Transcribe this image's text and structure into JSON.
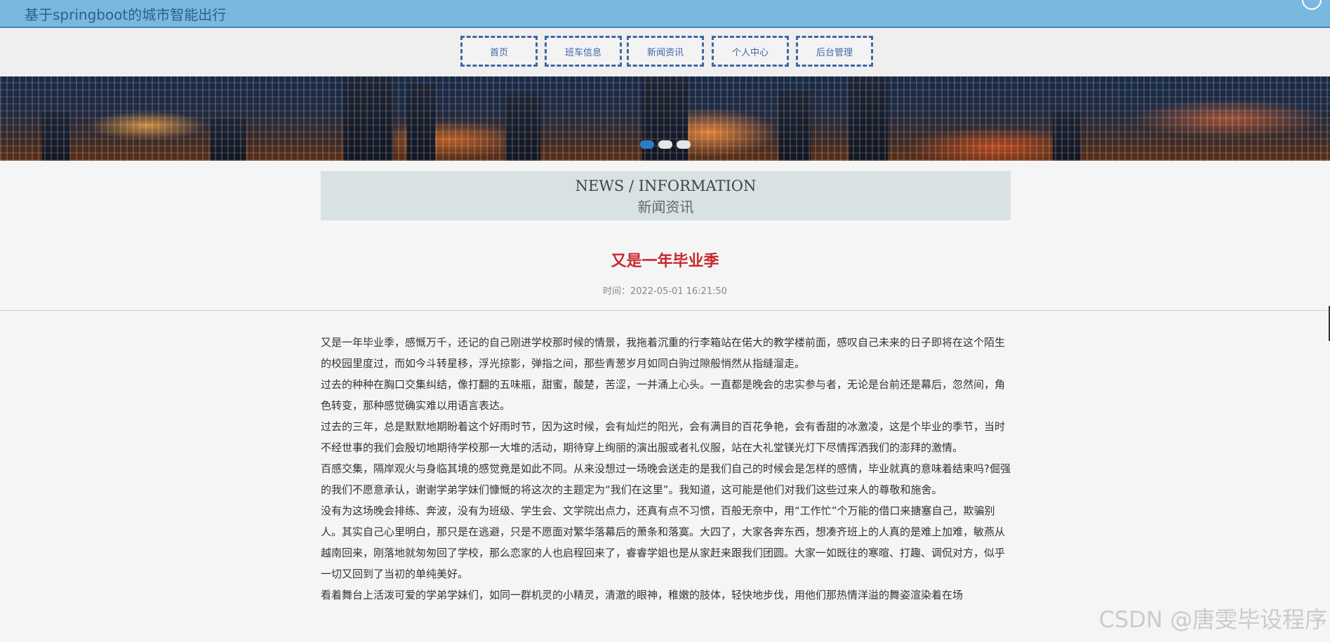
{
  "header": {
    "site_title": "基于springboot的城市智能出行"
  },
  "nav": {
    "items": [
      {
        "label": "首页"
      },
      {
        "label": "班车信息"
      },
      {
        "label": "新闻资讯"
      },
      {
        "label": "个人中心"
      },
      {
        "label": "后台管理"
      }
    ]
  },
  "section": {
    "title_en": "NEWS / INFORMATION",
    "title_zh": "新闻资讯"
  },
  "article": {
    "title": "又是一年毕业季",
    "time": "时间：2022-05-01 16:21:50",
    "paragraphs": [
      "又是一年毕业季，感慨万千，还记的自己刚进学校那时候的情景，我拖着沉重的行李箱站在偌大的教学楼前面，感叹自己未来的日子即将在这个陌生的校园里度过，而如今斗转星移，浮光掠影，弹指之间，那些青葱岁月如同白驹过隙般悄然从指缝溜走。",
      "过去的种种在胸口交集纠结，像打翻的五味瓶，甜蜜，酸楚，苦涩，一并涌上心头。一直都是晚会的忠实参与者，无论是台前还是幕后，忽然间，角色转变，那种感觉确实难以用语言表达。",
      "过去的三年，总是默默地期盼着这个好雨时节，因为这时候，会有灿烂的阳光，会有满目的百花争艳，会有香甜的冰激凌，这是个毕业的季节，当时不经世事的我们会殷切地期待学校那一大堆的活动，期待穿上绚丽的演出服或者礼仪服，站在大礼堂镁光灯下尽情挥洒我们的澎拜的激情。",
      "百感交集，隔岸观火与身临其境的感觉竟是如此不同。从来没想过一场晚会送走的是我们自己的时候会是怎样的感情，毕业就真的意味着结束吗?倔强的我们不愿意承认，谢谢学弟学妹们慷慨的将这次的主题定为“我们在这里”。我知道，这可能是他们对我们这些过来人的尊敬和施舍。",
      "没有为这场晚会排练、奔波，没有为班级、学生会、文学院出点力，还真有点不习惯，百般无奈中，用“工作忙”个万能的借口来搪塞自己，欺骗别人。其实自己心里明白，那只是在逃避，只是不愿面对繁华落幕后的萧条和落寞。大四了，大家各奔东西，想凑齐班上的人真的是难上加难，敏燕从越南回来，刚落地就匆匆回了学校，那么恋家的人也启程回来了，睿睿学姐也是从家赶来跟我们团圆。大家一如既往的寒暄、打趣、调侃对方，似乎一切又回到了当初的单纯美好。",
      "看着舞台上活泼可爱的学弟学妹们，如同一群机灵的小精灵，清澈的眼神，稚嫩的肢体，轻快地步伐，用他们那热情洋溢的舞姿渲染着在场"
    ]
  },
  "watermark": "CSDN @唐雯毕设程序",
  "colors": {
    "header_bg": "#7ab8de",
    "nav_border": "#3f67a4",
    "title_red": "#c8282d",
    "dot_active": "#2f7cc3"
  }
}
